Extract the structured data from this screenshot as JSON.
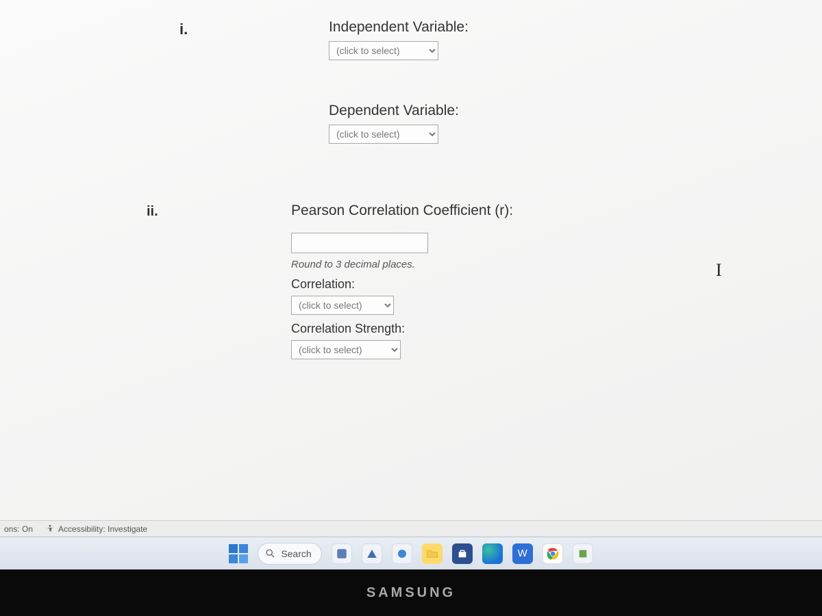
{
  "question": {
    "i": {
      "marker": "i.",
      "independent_label": "Independent Variable:",
      "independent_placeholder": "(click to select)",
      "dependent_label": "Dependent Variable:",
      "dependent_placeholder": "(click to select)"
    },
    "ii": {
      "marker": "ii.",
      "pearson_label": "Pearson Correlation Coefficient (r):",
      "round_hint": "Round to 3 decimal places.",
      "correlation_label": "Correlation:",
      "correlation_placeholder": "(click to select)",
      "strength_label": "Correlation Strength:",
      "strength_placeholder": "(click to select)"
    }
  },
  "status": {
    "ons": "ons: On",
    "accessibility": "Accessibility: Investigate"
  },
  "taskbar": {
    "search": "Search"
  },
  "bezel": {
    "brand": "SAMSUNG"
  }
}
